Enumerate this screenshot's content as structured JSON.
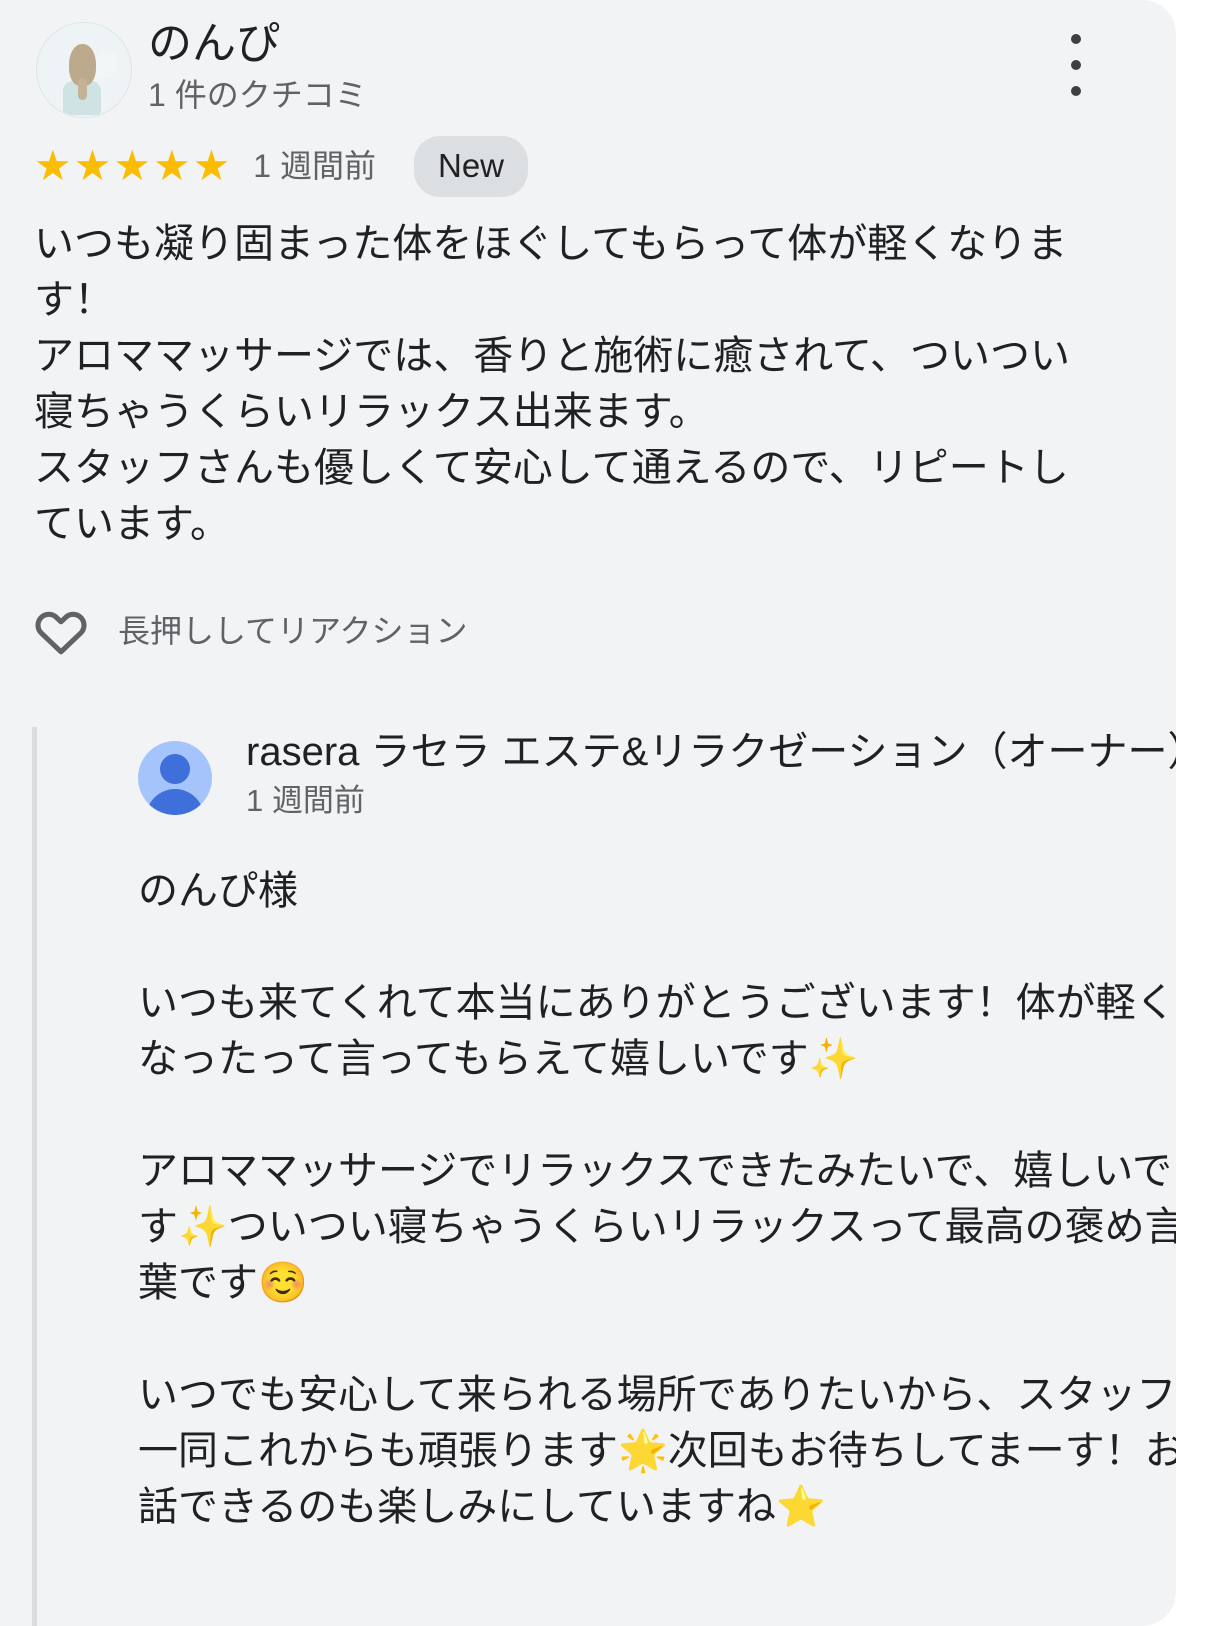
{
  "review": {
    "reviewer_name": "のんぴ",
    "reviewer_meta": "1 件のクチコミ",
    "rating_stars": "★★★★★",
    "rating_value": 5,
    "date": "1 週間前",
    "new_badge": "New",
    "body": "いつも凝り固まった体をほぐしてもらって体が軽くなります！\nアロママッサージでは、香りと施術に癒されて、ついつい寝ちゃうくらいリラックス出来ます。\nスタッフさんも優しくて安心して通えるので、リピートしています。",
    "reaction_label": "長押ししてリアクション"
  },
  "owner_reply": {
    "name": "rasera ラセラ エステ&リラクゼーション（オーナー）",
    "date": "1 週間前",
    "text": "のんぴ様\n\nいつも来てくれて本当にありがとうございます！体が軽くなったって言ってもらえて嬉しいです✨\n\nアロママッサージでリラックスできたみたいで、嬉しいです✨ついつい寝ちゃうくらいリラックスって最高の褒め言葉です☺️\n\nいつでも安心して来られる場所でありたいから、スタッフ一同これからも頑張ります🌟次回もお待ちしてまーす！お話できるのも楽しみにしていますね⭐"
  },
  "colors": {
    "card_background": "#f1f3f4",
    "page_background": "#ffffff",
    "star_gold": "#fbbc04",
    "primary_text": "#202124",
    "secondary_text": "#5f6368",
    "badge_background": "#dcdfe1",
    "reply_divider": "#dadce0",
    "avatar_blue_light": "#a5c4fc",
    "avatar_blue_dark": "#3f6fdb"
  }
}
